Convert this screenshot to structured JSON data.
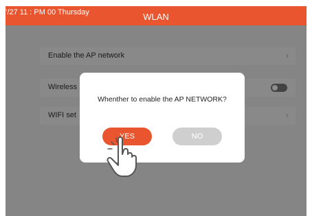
{
  "status_bar": {
    "text": "’/27 11 : PM 00 Thursday"
  },
  "header": {
    "title": "WLAN"
  },
  "settings": {
    "rows": [
      {
        "label": "Enable the AP network"
      },
      {
        "label": "Wireless"
      },
      {
        "label": "WIFI set"
      }
    ]
  },
  "dialog": {
    "message": "Whenther to enable the AP NETWORK?",
    "yes_label": "YES",
    "no_label": "NO"
  },
  "icons": {
    "pointer": "hand-pointer-icon",
    "chevron": "chevron-right-icon"
  },
  "colors": {
    "accent": "#e8552e",
    "secondary_button": "#cfcfcf"
  }
}
